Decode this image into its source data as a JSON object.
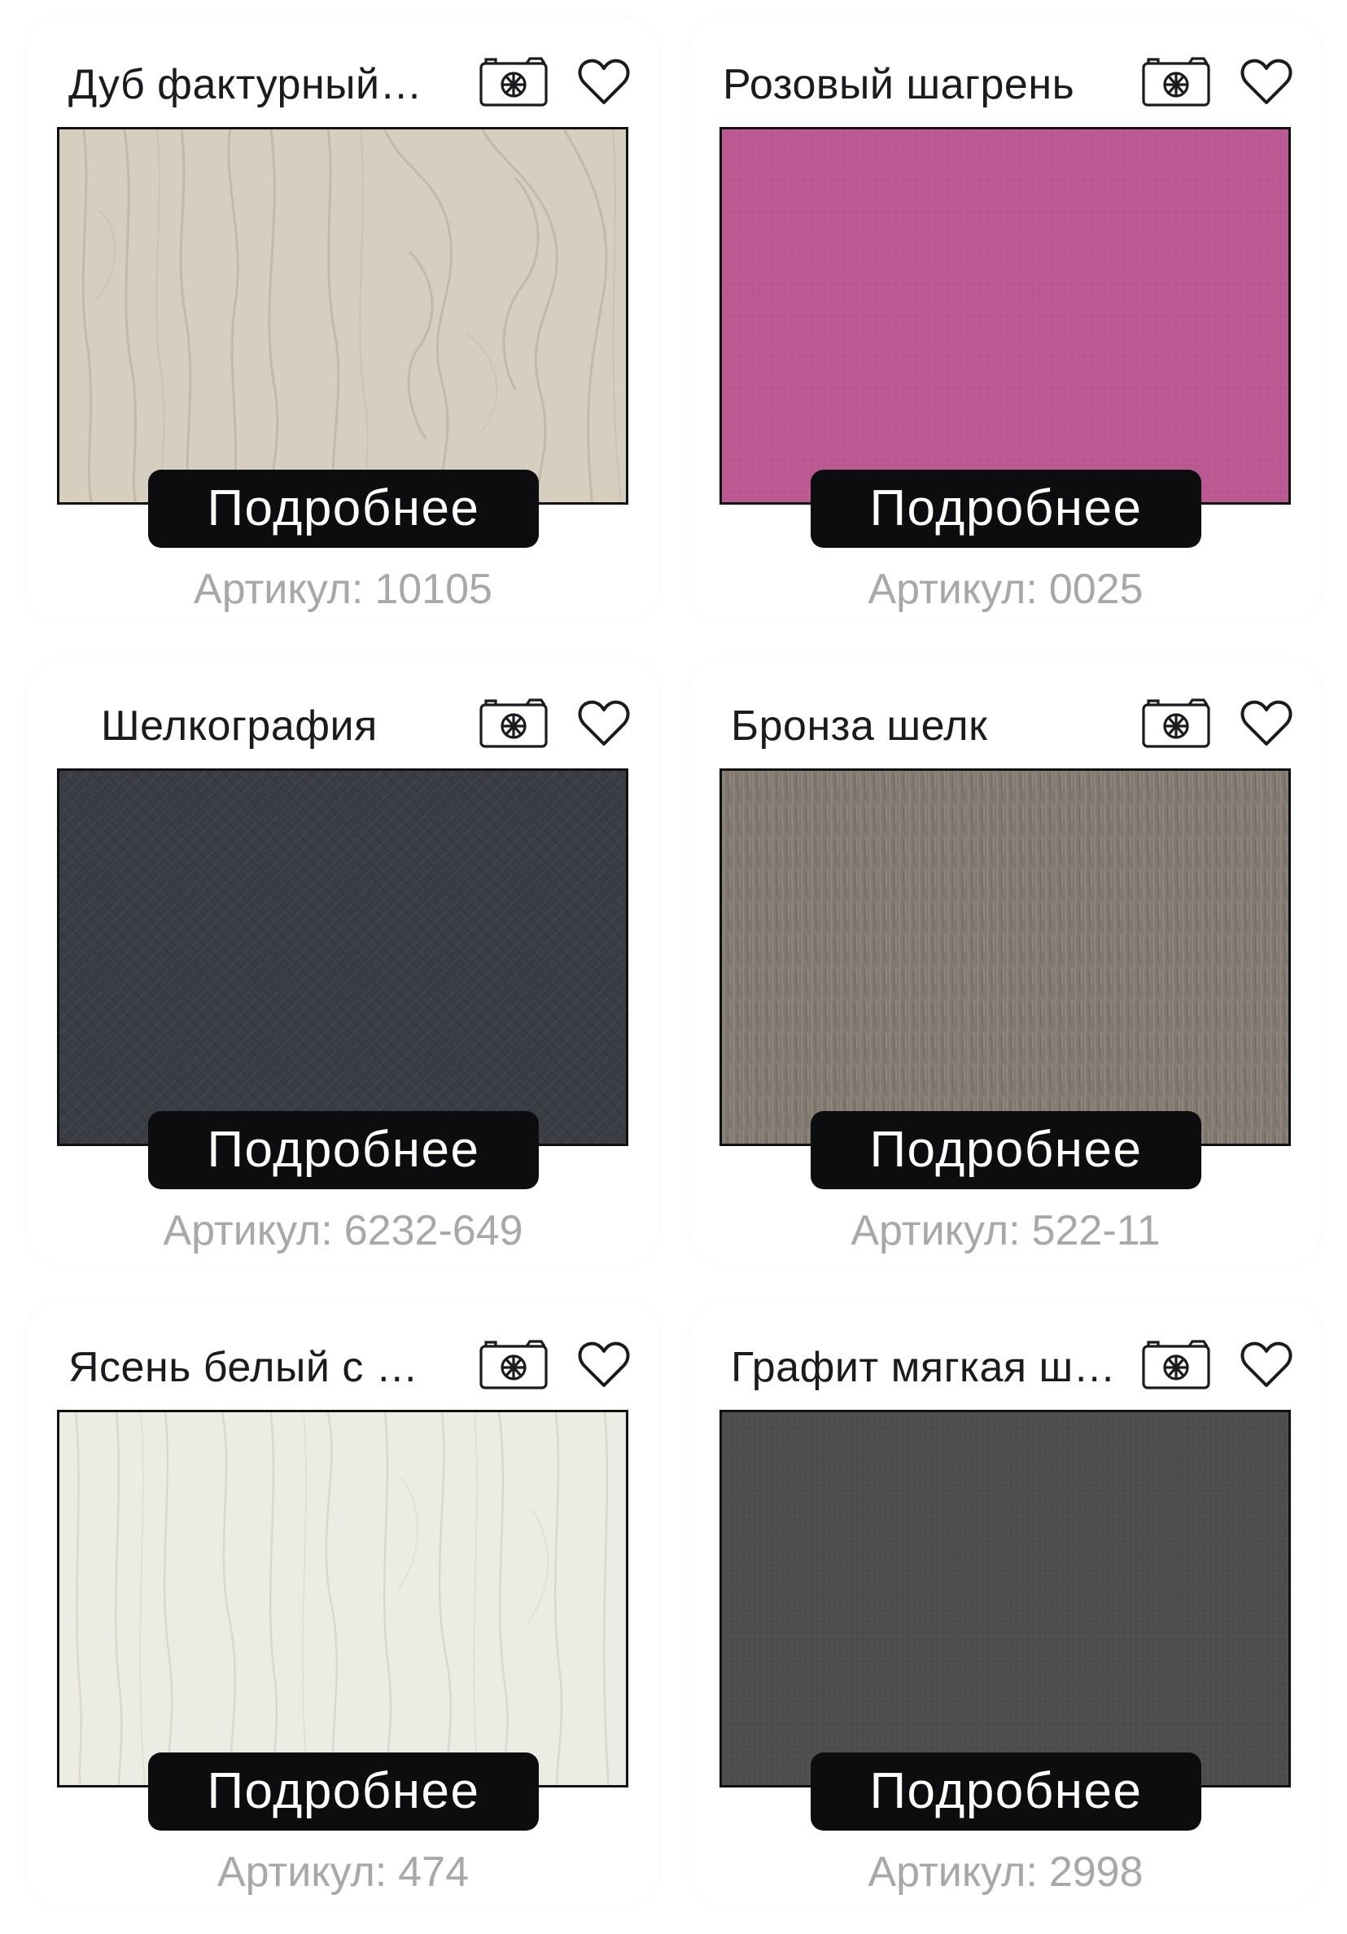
{
  "ui": {
    "details_label": "Подробнее",
    "article_label": "Артикул:",
    "colors": {
      "button_bg": "#0d0d0f",
      "article_text": "#a8a8a8",
      "title_text": "#1b1b1f"
    }
  },
  "products": [
    {
      "title": "Дуб фактурный…",
      "article": "10105",
      "texture": "oak-beige",
      "swatch_color": "#d6cfc0",
      "camera_icon": "camera-icon",
      "favorite_icon": "heart-outline-icon"
    },
    {
      "title": "Розовый шагрень",
      "article": "0025",
      "texture": "pink-shagreen",
      "swatch_color": "#bb5a92",
      "camera_icon": "camera-icon",
      "favorite_icon": "heart-outline-icon"
    },
    {
      "title": "Шелкография",
      "article": "6232-649",
      "texture": "dark-silk",
      "swatch_color": "#3a3d43",
      "camera_icon": "camera-icon",
      "favorite_icon": "heart-outline-icon"
    },
    {
      "title": "Бронза шелк",
      "article": "522-11",
      "texture": "bronze-silk",
      "swatch_color": "#827970",
      "camera_icon": "camera-icon",
      "favorite_icon": "heart-outline-icon"
    },
    {
      "title": "Ясень белый с …",
      "article": "474",
      "texture": "white-ash",
      "swatch_color": "#ecebe4",
      "camera_icon": "camera-icon",
      "favorite_icon": "heart-outline-icon"
    },
    {
      "title": "Графит мягкая ш…",
      "article": "2998",
      "texture": "graphite-soft",
      "swatch_color": "#4e4e4f",
      "camera_icon": "camera-icon",
      "favorite_icon": "heart-outline-icon"
    }
  ]
}
